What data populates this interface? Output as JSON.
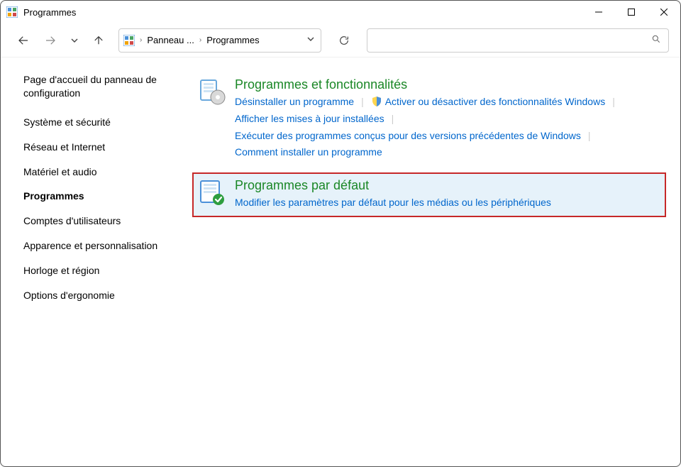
{
  "window": {
    "title": "Programmes"
  },
  "breadcrumb": {
    "part1": "Panneau ...",
    "part2": "Programmes"
  },
  "leftnav": {
    "home": "Page d'accueil du panneau de configuration",
    "items": [
      {
        "label": "Système et sécurité",
        "active": false
      },
      {
        "label": "Réseau et Internet",
        "active": false
      },
      {
        "label": "Matériel et audio",
        "active": false
      },
      {
        "label": "Programmes",
        "active": true
      },
      {
        "label": "Comptes d'utilisateurs",
        "active": false
      },
      {
        "label": "Apparence et personnalisation",
        "active": false
      },
      {
        "label": "Horloge et région",
        "active": false
      },
      {
        "label": "Options d'ergonomie",
        "active": false
      }
    ]
  },
  "categories": {
    "features": {
      "title": "Programmes et fonctionnalités",
      "links": {
        "uninstall": "Désinstaller un programme",
        "winfeat": "Activer ou désactiver des fonctionnalités Windows",
        "updates": "Afficher les mises à jour installées",
        "compat": "Exécuter des programmes conçus pour des versions précédentes de Windows",
        "howto": "Comment installer un programme"
      }
    },
    "defaults": {
      "title": "Programmes par défaut",
      "links": {
        "media": "Modifier les paramètres par défaut pour les médias ou les périphériques"
      }
    }
  }
}
